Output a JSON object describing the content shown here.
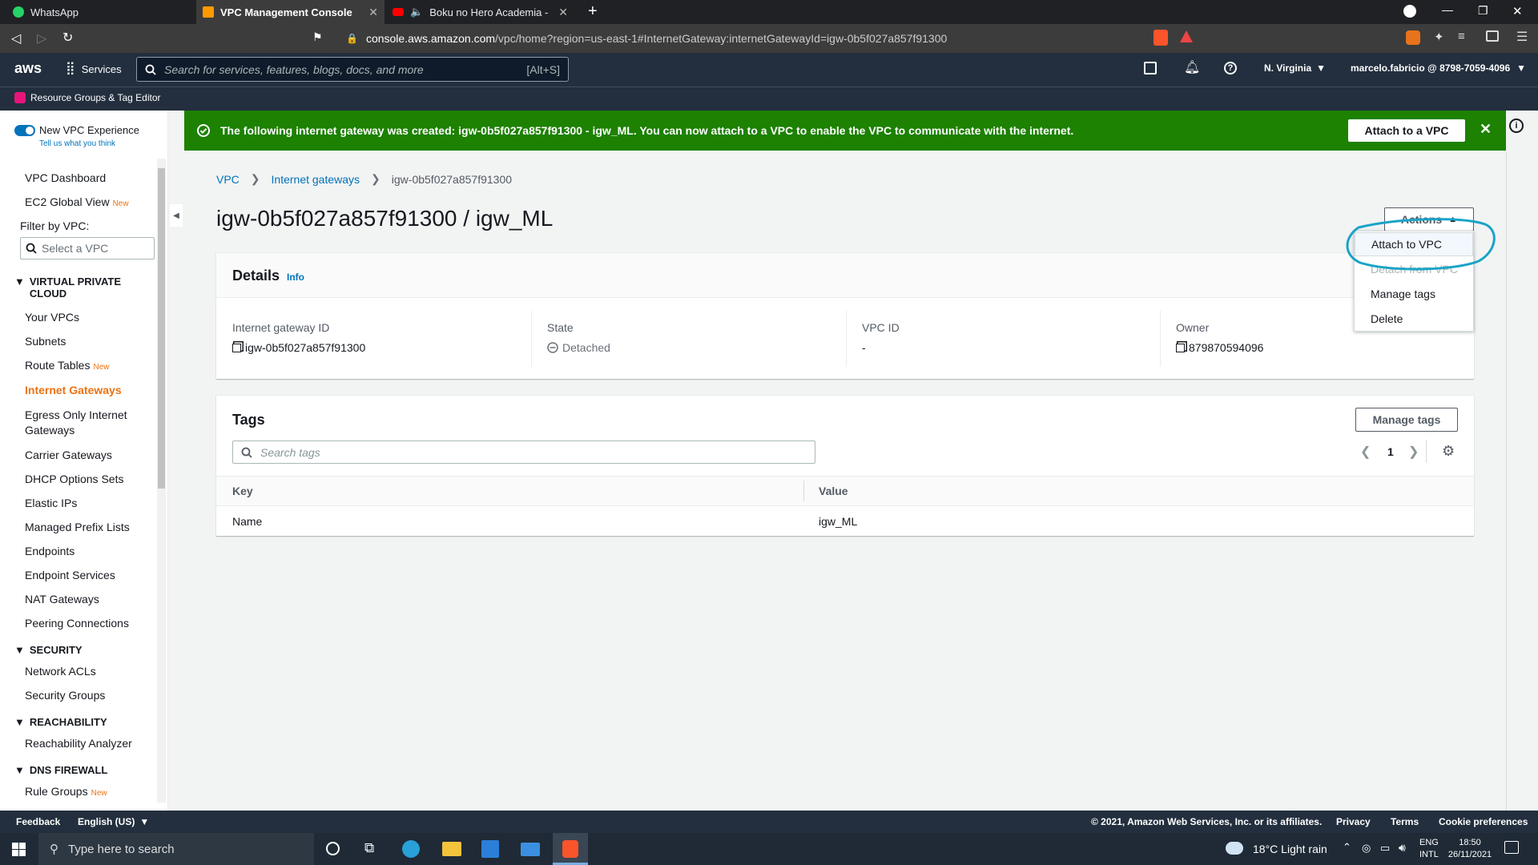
{
  "browser": {
    "tabs": [
      {
        "label": "WhatsApp"
      },
      {
        "label": "VPC Management Console"
      },
      {
        "label": "Boku no Hero Academia - Epic Bat"
      }
    ],
    "url_host": "console.aws.amazon.com",
    "url_path": "/vpc/home?region=us-east-1#InternetGateway:internetGatewayId=igw-0b5f027a857f91300"
  },
  "aws_header": {
    "logo": "aws",
    "services": "Services",
    "search_placeholder": "Search for services, features, blogs, docs, and more",
    "search_shortcut": "[Alt+S]",
    "region": "N. Virginia",
    "account": "marcelo.fabricio @ 8798-7059-4096",
    "resource_groups": "Resource Groups & Tag Editor"
  },
  "sidebar": {
    "toggle_label": "New VPC Experience",
    "feedback_link": "Tell us what you think",
    "dashboard": "VPC Dashboard",
    "ec2_global": "EC2 Global View",
    "new_badge": "New",
    "filter_label": "Filter by VPC:",
    "filter_placeholder": "Select a VPC",
    "sections": {
      "vpc": "VIRTUAL PRIVATE CLOUD",
      "security": "SECURITY",
      "reachability": "REACHABILITY",
      "dns": "DNS FIREWALL"
    },
    "vpc_items": [
      "Your VPCs",
      "Subnets",
      "Route Tables",
      "Internet Gateways",
      "Egress Only Internet Gateways",
      "Carrier Gateways",
      "DHCP Options Sets",
      "Elastic IPs",
      "Managed Prefix Lists",
      "Endpoints",
      "Endpoint Services",
      "NAT Gateways",
      "Peering Connections"
    ],
    "security_items": [
      "Network ACLs",
      "Security Groups"
    ],
    "reachability_items": [
      "Reachability Analyzer"
    ],
    "dns_items": [
      "Rule Groups"
    ]
  },
  "banner": {
    "message": "The following internet gateway was created: igw-0b5f027a857f91300 - igw_ML. You can now attach to a VPC to enable the VPC to communicate with the internet.",
    "button": "Attach to a VPC"
  },
  "breadcrumb": [
    "VPC",
    "Internet gateways",
    "igw-0b5f027a857f91300"
  ],
  "page_title": "igw-0b5f027a857f91300 / igw_ML",
  "actions": {
    "label": "Actions",
    "items": [
      "Attach to VPC",
      "Detach from VPC",
      "Manage tags",
      "Delete"
    ]
  },
  "details": {
    "title": "Details",
    "info": "Info",
    "igw_label": "Internet gateway ID",
    "igw_value": "igw-0b5f027a857f91300",
    "state_label": "State",
    "state_value": "Detached",
    "vpc_label": "VPC ID",
    "vpc_value": "-",
    "owner_label": "Owner",
    "owner_value": "879870594096"
  },
  "tags": {
    "title": "Tags",
    "manage_button": "Manage tags",
    "search_placeholder": "Search tags",
    "page": "1",
    "col_key": "Key",
    "col_value": "Value",
    "rows": [
      {
        "key": "Name",
        "value": "igw_ML"
      }
    ]
  },
  "footer": {
    "feedback": "Feedback",
    "language": "English (US)",
    "copyright": "© 2021, Amazon Web Services, Inc. or its affiliates.",
    "privacy": "Privacy",
    "terms": "Terms",
    "cookies": "Cookie preferences"
  },
  "taskbar": {
    "search_placeholder": "Type here to search",
    "weather": "18°C  Light rain",
    "lang1": "ENG",
    "lang2": "INTL",
    "time": "18:50",
    "date": "26/11/2021"
  },
  "colors": {
    "aws_navy": "#232f3e",
    "success_green": "#1d8102",
    "link_blue": "#0073bb",
    "active_orange": "#ec7211",
    "annotation_circle": "#1aa3c7"
  }
}
